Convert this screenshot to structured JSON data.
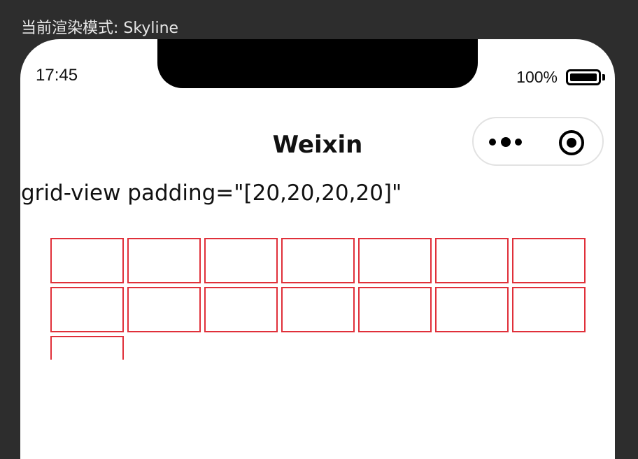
{
  "render_mode": "当前渲染模式: Skyline",
  "status_bar": {
    "time": "17:45",
    "battery_text": "100%",
    "battery_level": 1.0
  },
  "nav": {
    "title": "Weixin"
  },
  "heading": "grid-view padding=\"[20,20,20,20]\"",
  "grid": {
    "columns": 7,
    "cell_count": 15,
    "border_color": "#e0303a"
  }
}
